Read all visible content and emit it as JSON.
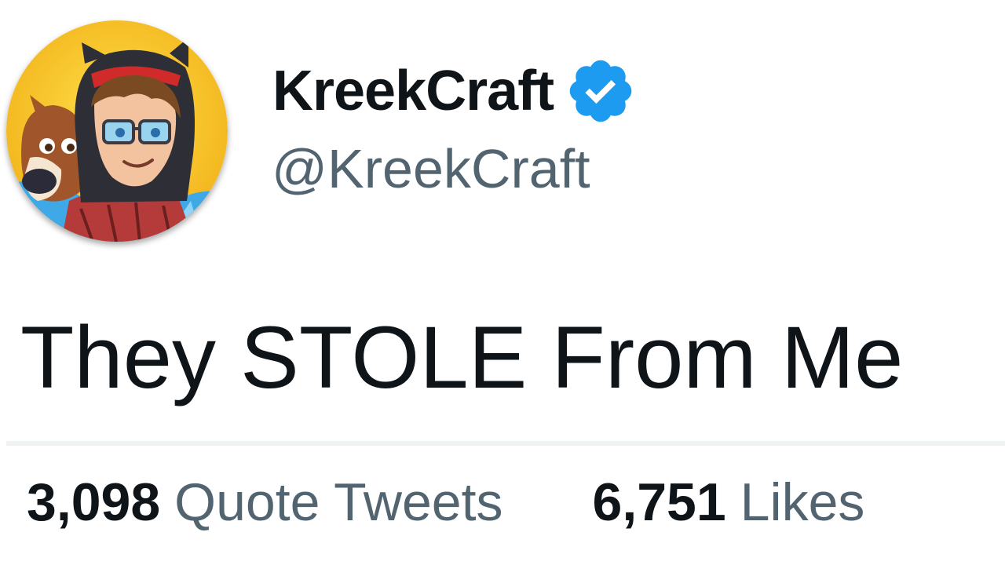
{
  "profile": {
    "display_name": "KreekCraft",
    "handle": "@KreekCraft",
    "verified": true,
    "avatar_icon": "cartoon-avatar"
  },
  "tweet": {
    "text": "They STOLE From Me"
  },
  "stats": {
    "quote_tweets": {
      "count": "3,098",
      "label": "Quote Tweets"
    },
    "likes": {
      "count": "6,751",
      "label": "Likes"
    }
  },
  "colors": {
    "text_primary": "#0f1419",
    "text_secondary": "#536471",
    "verified_blue": "#1d9bf0",
    "divider": "#eff3f4"
  }
}
